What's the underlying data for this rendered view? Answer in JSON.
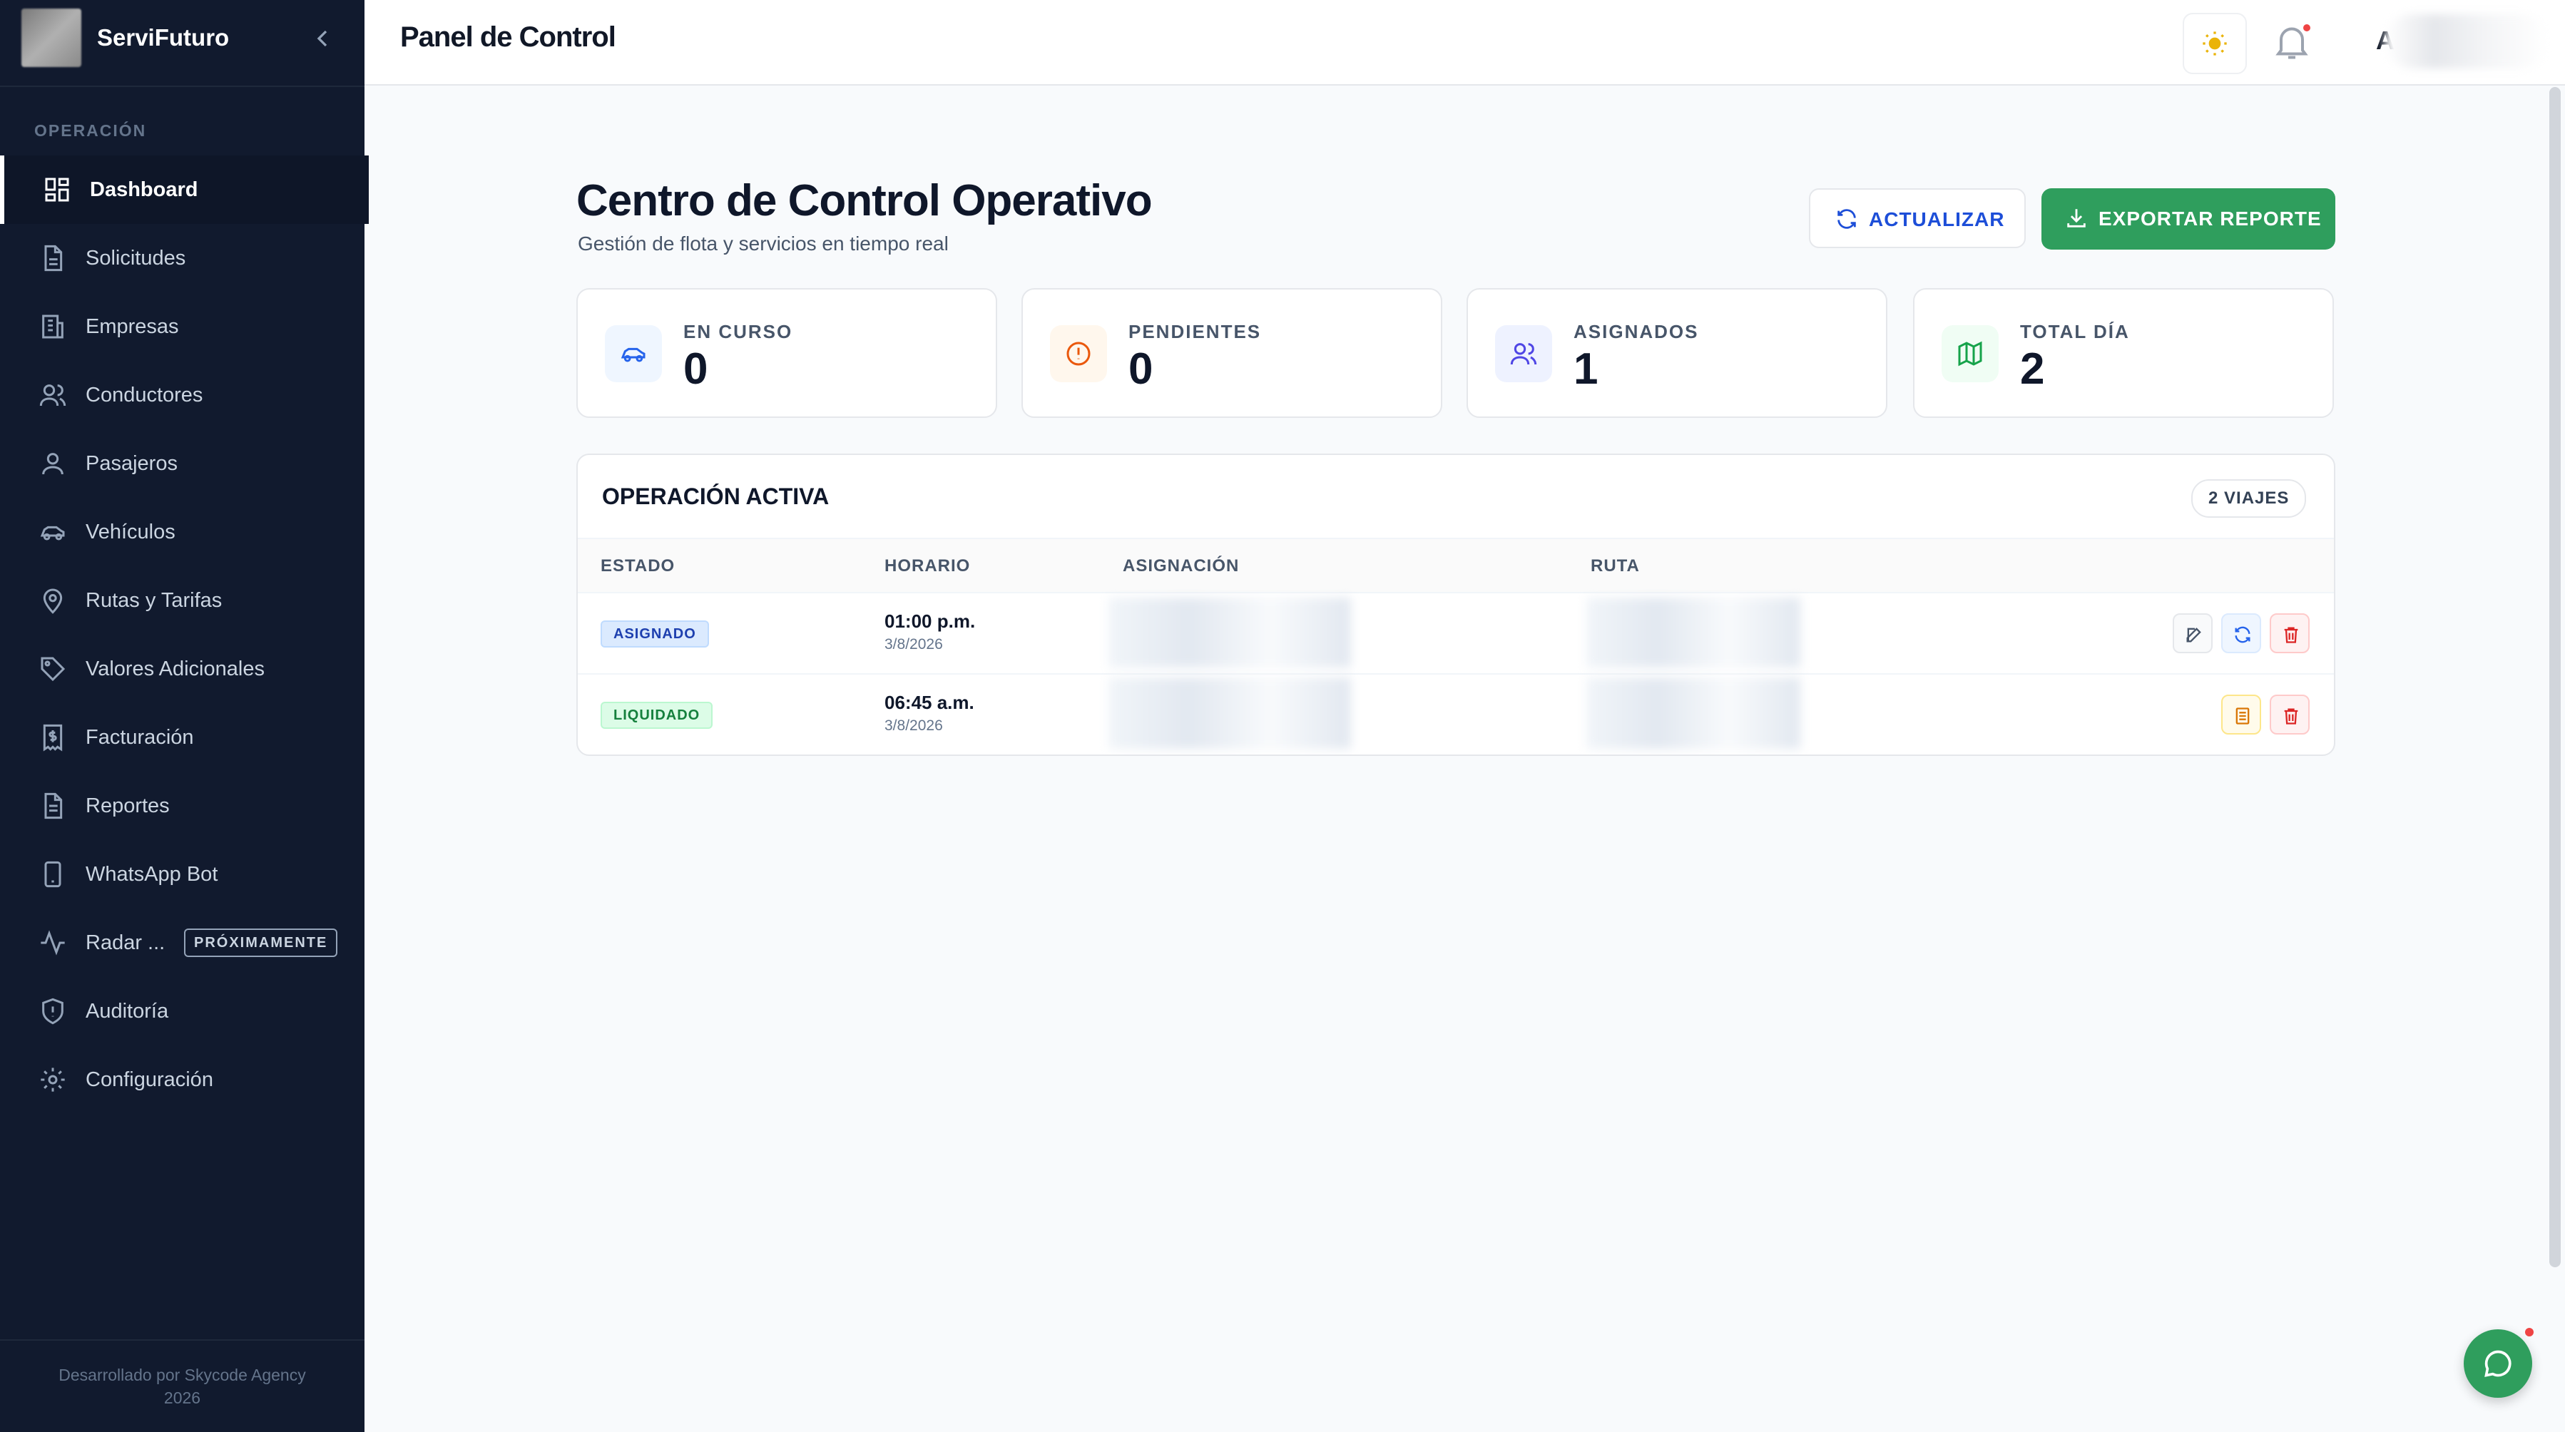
{
  "app": {
    "name": "ServiFuturo"
  },
  "header": {
    "title": "Panel de Control",
    "user_initial": "A"
  },
  "sidebar": {
    "section": "OPERACIÓN",
    "items": [
      {
        "label": "Dashboard",
        "icon": "dashboard-icon"
      },
      {
        "label": "Solicitudes",
        "icon": "document-icon"
      },
      {
        "label": "Empresas",
        "icon": "building-icon"
      },
      {
        "label": "Conductores",
        "icon": "users-icon"
      },
      {
        "label": "Pasajeros",
        "icon": "user-icon"
      },
      {
        "label": "Vehículos",
        "icon": "car-icon"
      },
      {
        "label": "Rutas y Tarifas",
        "icon": "map-pin-icon"
      },
      {
        "label": "Valores Adicionales",
        "icon": "tag-icon"
      },
      {
        "label": "Facturación",
        "icon": "receipt-icon"
      },
      {
        "label": "Reportes",
        "icon": "file-text-icon"
      },
      {
        "label": "WhatsApp Bot",
        "icon": "smartphone-icon"
      },
      {
        "label": "Radar ...",
        "icon": "activity-icon",
        "badge": "PRÓXIMAMENTE"
      },
      {
        "label": "Auditoría",
        "icon": "shield-icon"
      },
      {
        "label": "Configuración",
        "icon": "gear-icon"
      }
    ],
    "footer_line1": "Desarrollado por Skycode Agency",
    "footer_line2": "2026"
  },
  "main": {
    "title": "Centro de Control Operativo",
    "subtitle": "Gestión de flota y servicios en tiempo real",
    "refresh_label": "ACTUALIZAR",
    "export_label": "EXPORTAR REPORTE",
    "stats": [
      {
        "label": "EN CURSO",
        "value": "0",
        "icon": "car-icon",
        "color": "#2563eb"
      },
      {
        "label": "PENDIENTES",
        "value": "0",
        "icon": "alert-circle-icon",
        "color": "#ea580c"
      },
      {
        "label": "ASIGNADOS",
        "value": "1",
        "icon": "users-icon",
        "color": "#4f46e5"
      },
      {
        "label": "TOTAL DÍA",
        "value": "2",
        "icon": "map-icon",
        "color": "#16a34a"
      }
    ],
    "table": {
      "title": "OPERACIÓN ACTIVA",
      "count": "2 VIAJES",
      "columns": [
        "ESTADO",
        "HORARIO",
        "ASIGNACIÓN",
        "RUTA"
      ],
      "rows": [
        {
          "status": "ASIGNADO",
          "time": "01:00 p.m.",
          "date": "3/8/2026"
        },
        {
          "status": "LIQUIDADO",
          "time": "06:45 a.m.",
          "date": "3/8/2026"
        }
      ]
    }
  },
  "colors": {
    "sidebar": "#111a2e",
    "accent_green": "#2f9e5d",
    "accent_blue": "#1d4ed8"
  }
}
